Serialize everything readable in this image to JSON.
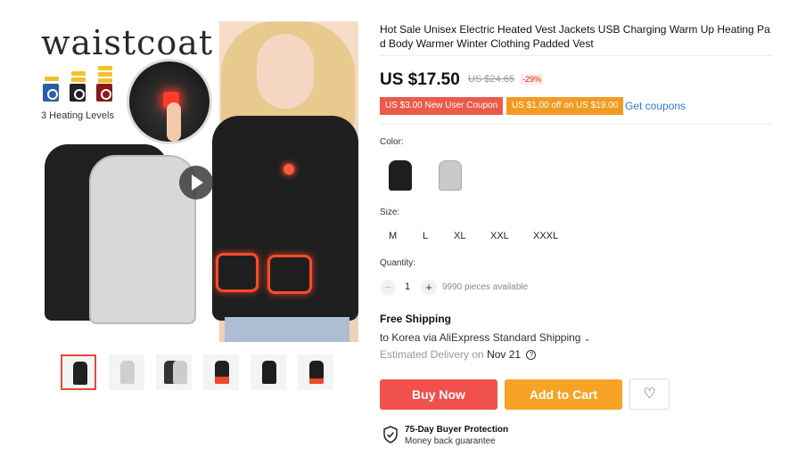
{
  "gallery": {
    "image_brand_text": "waistcoat",
    "levels_label": "3 Heating Levels",
    "thumbnails": [
      "thumb-1",
      "thumb-2",
      "thumb-3",
      "thumb-4",
      "thumb-5",
      "thumb-6"
    ]
  },
  "product": {
    "title": "Hot Sale Unisex Electric Heated Vest Jackets USB Charging Warm Up Heating Pad Body Warmer Winter Clothing Padded Vest",
    "price": "US $17.50",
    "original_price": "US $24.65",
    "discount": "-29%"
  },
  "coupons": {
    "new_user": "US $3.00 New User Coupon",
    "store": "US $1.00 off on US $19.00",
    "get_link": "Get coupons"
  },
  "color": {
    "label": "Color:",
    "options": [
      {
        "name": "black",
        "hex": "#1e1e1e"
      },
      {
        "name": "grey",
        "hex": "#c9c9c9"
      }
    ]
  },
  "size": {
    "label": "Size:",
    "options": [
      "M",
      "L",
      "XL",
      "XXL",
      "XXXL"
    ]
  },
  "quantity": {
    "label": "Quantity:",
    "minus": "−",
    "value": "1",
    "plus": "+",
    "available": "9990 pieces available"
  },
  "shipping": {
    "title": "Free Shipping",
    "destination": "to Korea via AliExpress Standard Shipping",
    "delivery_label": "Estimated Delivery on",
    "delivery_date": "Nov 21"
  },
  "actions": {
    "buy_now": "Buy Now",
    "add_to_cart": "Add to Cart",
    "wishlist_icon": "heart-icon"
  },
  "protection": {
    "title": "75-Day Buyer Protection",
    "subtitle": "Money back guarantee"
  },
  "colors": {
    "buy": "#f0514d",
    "cart": "#f7a325",
    "link": "#2e7ad8",
    "coupon_red": "#ec5a4a",
    "coupon_orange": "#f39b21"
  }
}
